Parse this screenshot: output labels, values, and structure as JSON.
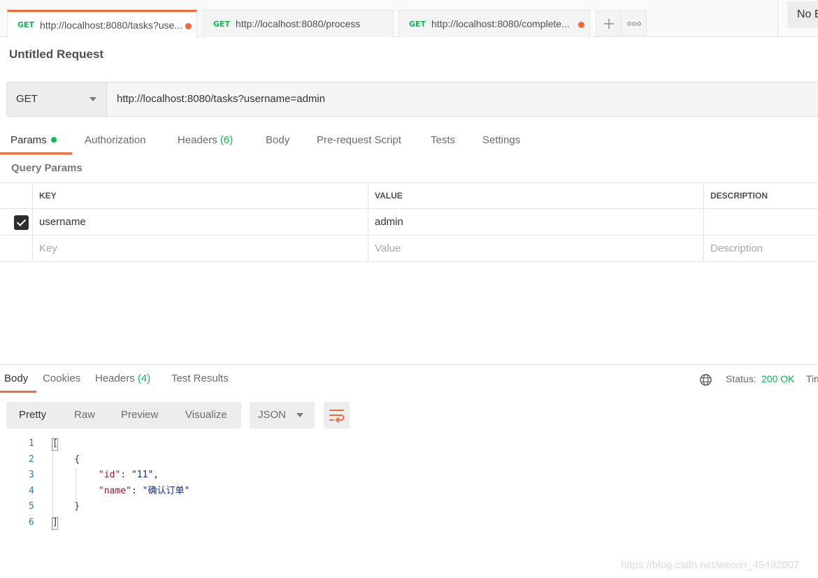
{
  "tabs": [
    {
      "method": "GET",
      "url": "http://localhost:8080/tasks?use...",
      "unsaved": true,
      "active": true
    },
    {
      "method": "GET",
      "url": "http://localhost:8080/process",
      "unsaved": false,
      "active": false
    },
    {
      "method": "GET",
      "url": "http://localhost:8080/complete...",
      "unsaved": true,
      "active": false
    }
  ],
  "tab_actions": {
    "add_icon": "plus-icon",
    "more_icon": "more-options-icon"
  },
  "environment": {
    "label": "No E"
  },
  "request": {
    "title": "Untitled Request",
    "method": "GET",
    "url": "http://localhost:8080/tasks?username=admin"
  },
  "request_tabs": {
    "params": "Params",
    "authorization": "Authorization",
    "headers": "Headers",
    "headers_count": "(6)",
    "body": "Body",
    "pre_request": "Pre-request Script",
    "tests": "Tests",
    "settings": "Settings"
  },
  "query_params": {
    "label": "Query Params",
    "columns": {
      "key": "KEY",
      "value": "VALUE",
      "description": "DESCRIPTION"
    },
    "rows": [
      {
        "checked": true,
        "key": "username",
        "value": "admin",
        "description": ""
      }
    ],
    "placeholders": {
      "key": "Key",
      "value": "Value",
      "description": "Description"
    }
  },
  "response": {
    "tabs": {
      "body": "Body",
      "cookies": "Cookies",
      "headers": "Headers",
      "headers_count": "(4)",
      "test_results": "Test Results"
    },
    "status_label": "Status:",
    "status_value": "200 OK",
    "time_label": "Time",
    "views": {
      "pretty": "Pretty",
      "raw": "Raw",
      "preview": "Preview",
      "visualize": "Visualize"
    },
    "format": "JSON",
    "code_lines": [
      {
        "n": "1",
        "text": "["
      },
      {
        "n": "2",
        "text": "    {"
      },
      {
        "n": "3",
        "key": "\"id\"",
        "sep": ": ",
        "value": "\"11\"",
        "end": ","
      },
      {
        "n": "4",
        "key": "\"name\"",
        "sep": ": ",
        "value": "\"确认订单\"",
        "end": ""
      },
      {
        "n": "5",
        "text": "    }"
      },
      {
        "n": "6",
        "text": "]"
      }
    ]
  },
  "watermark": "https://blog.csdn.net/weixin_45492007",
  "colors": {
    "accent": "#f26b3a",
    "success": "#0cbb52",
    "json_key": "#a3142b",
    "json_string": "#0d2e8a"
  }
}
